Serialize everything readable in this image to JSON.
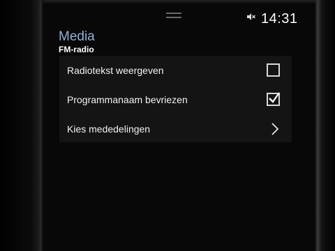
{
  "status_bar": {
    "time": "14:31",
    "volume_icon": "speaker-muted-icon"
  },
  "header": {
    "title": "Media",
    "subtitle": "FM-radio"
  },
  "settings": [
    {
      "label": "Radiotekst weergeven",
      "control": "checkbox",
      "checked": false
    },
    {
      "label": "Programmanaam bevriezen",
      "control": "checkbox",
      "checked": true
    },
    {
      "label": "Kies mededelingen",
      "control": "chevron",
      "icon": "chevron-right-icon"
    }
  ],
  "colors": {
    "accent_title": "#8fb1d6",
    "panel_bg": "#141414"
  }
}
